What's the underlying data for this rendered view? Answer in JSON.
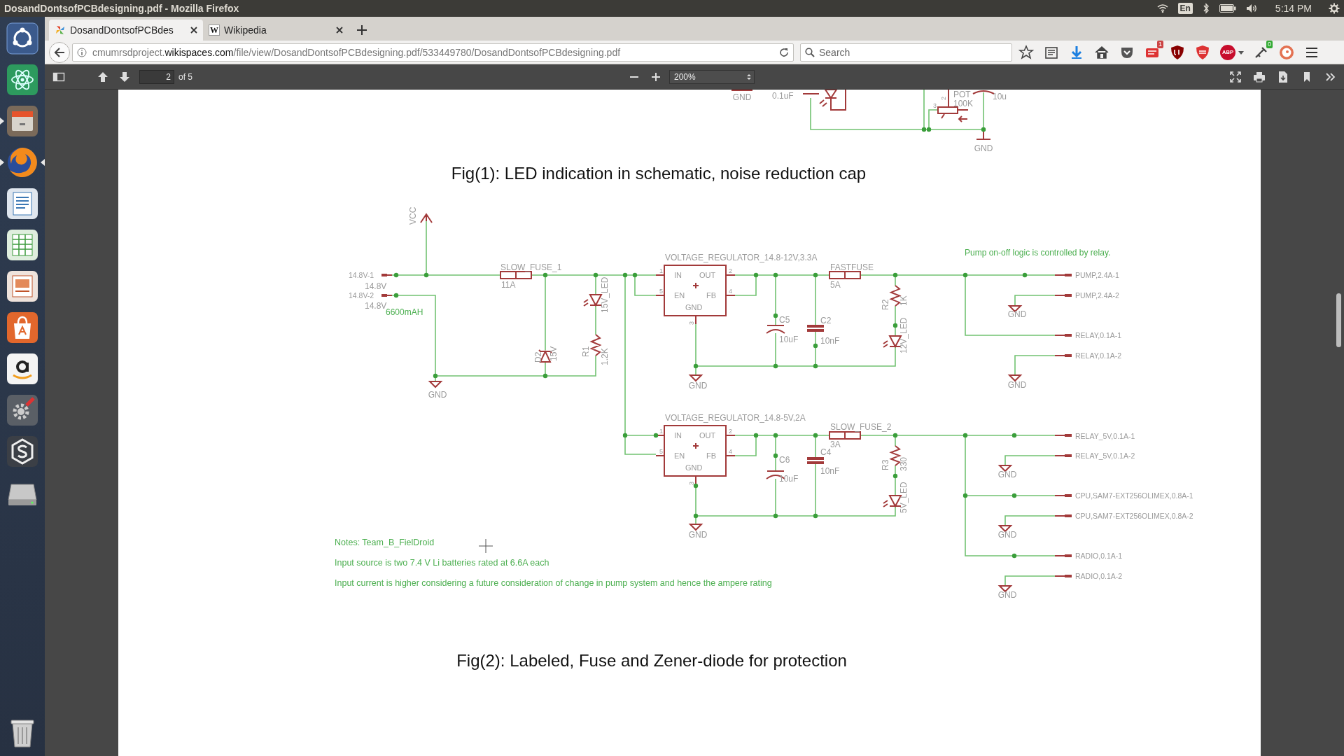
{
  "top_panel": {
    "title": "DosandDontsofPCBdesigning.pdf - Mozilla Firefox",
    "keyboard_layout": "En",
    "time": "5:14 PM"
  },
  "launcher": [
    {
      "kind": "dash",
      "running": false,
      "focused": false
    },
    {
      "kind": "atom",
      "running": false,
      "focused": false
    },
    {
      "kind": "files",
      "running": true,
      "focused": false
    },
    {
      "kind": "firefox",
      "running": true,
      "focused": true
    },
    {
      "kind": "writer",
      "running": false,
      "focused": false
    },
    {
      "kind": "calc",
      "running": false,
      "focused": false
    },
    {
      "kind": "impress",
      "running": false,
      "focused": false
    },
    {
      "kind": "software",
      "running": false,
      "focused": false
    },
    {
      "kind": "amazon",
      "running": false,
      "focused": false
    },
    {
      "kind": "settings",
      "running": false,
      "focused": false
    },
    {
      "kind": "snap",
      "running": false,
      "focused": false
    },
    {
      "kind": "drive",
      "running": false,
      "focused": false
    },
    {
      "kind": "trash",
      "running": false,
      "focused": false
    }
  ],
  "tabs": [
    {
      "title": "DosandDontsofPCBdes",
      "selected": true
    },
    {
      "title": "Wikipedia",
      "icon_letter": "W",
      "selected": false
    }
  ],
  "address_bar": {
    "url_subdomain": "cmumrsdproject.",
    "url_domain": "wikispaces.com",
    "url_path": "/file/view/DosandDontsofPCBdesigning.pdf/533449780/DosandDontsofPCBdesigning.pdf"
  },
  "search": {
    "placeholder": "Search"
  },
  "toolbar": {
    "notification_count": "1",
    "adblock_label": "ABP",
    "extension_count": "0"
  },
  "pdf_toolbar": {
    "page": "2",
    "page_count": "of 5",
    "zoom": "200%"
  },
  "figure_1": {
    "labels": [
      {
        "text": "GND",
        "kind": "part"
      },
      {
        "text": "0.1uF",
        "kind": "part"
      },
      {
        "text": "3",
        "kind": "part"
      },
      {
        "text": "2",
        "kind": "part"
      },
      {
        "text": "POT",
        "kind": "part"
      },
      {
        "text": "100K",
        "kind": "part"
      },
      {
        "text": "10u",
        "kind": "part"
      },
      {
        "text": "GND",
        "kind": "part"
      }
    ],
    "caption": "Fig(1): LED indication in schematic, noise reduction cap"
  },
  "figure_2": {
    "labels": [
      {
        "text": "VCC",
        "kind": "part"
      },
      {
        "text": "14.8V-1",
        "kind": "part"
      },
      {
        "text": "14.8V",
        "kind": "part"
      },
      {
        "text": "14.8V-2",
        "kind": "part"
      },
      {
        "text": "14.8V",
        "kind": "part"
      },
      {
        "text": "6600mAH",
        "kind": "note"
      },
      {
        "text": "SLOW_FUSE_1",
        "kind": "part"
      },
      {
        "text": "11A",
        "kind": "part"
      },
      {
        "text": "D2",
        "kind": "part"
      },
      {
        "text": "15V",
        "kind": "part"
      },
      {
        "text": "15V_LED",
        "kind": "part"
      },
      {
        "text": "R1",
        "kind": "part"
      },
      {
        "text": "1.2K",
        "kind": "part"
      },
      {
        "text": "GND",
        "kind": "part"
      },
      {
        "text": "VOLTAGE_REGULATOR_14.8-12V,3.3A",
        "kind": "part"
      },
      {
        "text": "1",
        "kind": "part"
      },
      {
        "text": "IN",
        "kind": "part"
      },
      {
        "text": "OUT",
        "kind": "part"
      },
      {
        "text": "2",
        "kind": "part"
      },
      {
        "text": "5",
        "kind": "part"
      },
      {
        "text": "EN",
        "kind": "part"
      },
      {
        "text": "FB",
        "kind": "part"
      },
      {
        "text": "4",
        "kind": "part"
      },
      {
        "text": "GND",
        "kind": "part"
      },
      {
        "text": "3",
        "kind": "part"
      },
      {
        "text": "GND",
        "kind": "part"
      },
      {
        "text": "C5",
        "kind": "part"
      },
      {
        "text": "10uF",
        "kind": "part"
      },
      {
        "text": "C2",
        "kind": "part"
      },
      {
        "text": "10nF",
        "kind": "part"
      },
      {
        "text": "FASTFUSE",
        "kind": "part"
      },
      {
        "text": "5A",
        "kind": "part"
      },
      {
        "text": "R2",
        "kind": "part"
      },
      {
        "text": "1K",
        "kind": "part"
      },
      {
        "text": "12V_LED",
        "kind": "part"
      },
      {
        "text": "Pump on-off logic is controlled by relay.",
        "kind": "note"
      },
      {
        "text": "PUMP,2.4A-1",
        "kind": "part"
      },
      {
        "text": "PUMP,2.4A-2",
        "kind": "part"
      },
      {
        "text": "GND",
        "kind": "part"
      },
      {
        "text": "RELAY,0.1A-1",
        "kind": "part"
      },
      {
        "text": "RELAY,0.1A-2",
        "kind": "part"
      },
      {
        "text": "GND",
        "kind": "part"
      },
      {
        "text": "VOLTAGE_REGULATOR_14.8-5V,2A",
        "kind": "part"
      },
      {
        "text": "1",
        "kind": "part"
      },
      {
        "text": "IN",
        "kind": "part"
      },
      {
        "text": "OUT",
        "kind": "part"
      },
      {
        "text": "2",
        "kind": "part"
      },
      {
        "text": "5",
        "kind": "part"
      },
      {
        "text": "EN",
        "kind": "part"
      },
      {
        "text": "FB",
        "kind": "part"
      },
      {
        "text": "4",
        "kind": "part"
      },
      {
        "text": "GND",
        "kind": "part"
      },
      {
        "text": "3",
        "kind": "part"
      },
      {
        "text": "GND",
        "kind": "part"
      },
      {
        "text": "C6",
        "kind": "part"
      },
      {
        "text": "10uF",
        "kind": "part"
      },
      {
        "text": "SLOW_FUSE_2",
        "kind": "part"
      },
      {
        "text": "3A",
        "kind": "part"
      },
      {
        "text": "C4",
        "kind": "part"
      },
      {
        "text": "10nF",
        "kind": "part"
      },
      {
        "text": "R3",
        "kind": "part"
      },
      {
        "text": "330",
        "kind": "part"
      },
      {
        "text": "5V_LED",
        "kind": "part"
      },
      {
        "text": "RELAY_5V,0.1A-1",
        "kind": "part"
      },
      {
        "text": "RELAY_5V,0.1A-2",
        "kind": "part"
      },
      {
        "text": "GND",
        "kind": "part"
      },
      {
        "text": "CPU,SAM7-EXT256OLIMEX,0.8A-1",
        "kind": "part"
      },
      {
        "text": "CPU,SAM7-EXT256OLIMEX,0.8A-2",
        "kind": "part"
      },
      {
        "text": "GND",
        "kind": "part"
      },
      {
        "text": "RADIO,0.1A-1",
        "kind": "part"
      },
      {
        "text": "RADIO,0.1A-2",
        "kind": "part"
      },
      {
        "text": "GND",
        "kind": "part"
      },
      {
        "text": "Notes: Team_B_FielDroid",
        "kind": "note"
      },
      {
        "text": "Input source is two 7.4 V Li batteries rated at 6.6A each",
        "kind": "note"
      },
      {
        "text": "Input current is higher considering a future consideration of change in pump system and hence the ampere rating",
        "kind": "note"
      }
    ],
    "caption": "Fig(2): Labeled, Fuse and Zener-diode for protection"
  }
}
